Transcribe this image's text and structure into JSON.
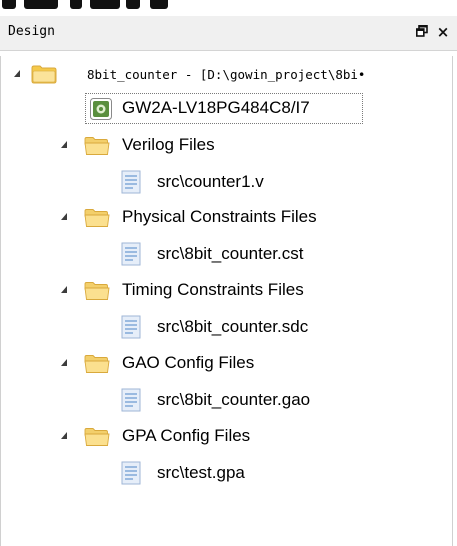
{
  "panel": {
    "title": "Design",
    "float_button_icon": "float-window-icon",
    "close_glyph": "×"
  },
  "tree": {
    "project": {
      "label": "8bit_counter - [D:\\gowin_project\\8bi•",
      "icon": "project-folder-icon",
      "expanded": true
    },
    "device": {
      "label": "GW2A-LV18PG484C8/I7",
      "icon": "device-chip-icon",
      "selected": true
    },
    "groups": [
      {
        "label": "Verilog Files",
        "expanded": true,
        "files": [
          {
            "label": "src\\counter1.v"
          }
        ]
      },
      {
        "label": "Physical Constraints Files",
        "expanded": true,
        "files": [
          {
            "label": "src\\8bit_counter.cst"
          }
        ]
      },
      {
        "label": "Timing Constraints Files",
        "expanded": true,
        "files": [
          {
            "label": "src\\8bit_counter.sdc"
          }
        ]
      },
      {
        "label": "GAO Config Files",
        "expanded": true,
        "files": [
          {
            "label": "src\\8bit_counter.gao"
          }
        ]
      },
      {
        "label": "GPA Config Files",
        "expanded": true,
        "files": [
          {
            "label": "src\\test.gpa"
          }
        ]
      }
    ]
  },
  "colors": {
    "folder_fill": "#f5d67a",
    "folder_edge": "#d9a93c",
    "file_fill": "#dfe9f7",
    "file_lines": "#7aa3d6",
    "chip_fill": "#5a8f3e",
    "expander": "#3c3c3c"
  }
}
